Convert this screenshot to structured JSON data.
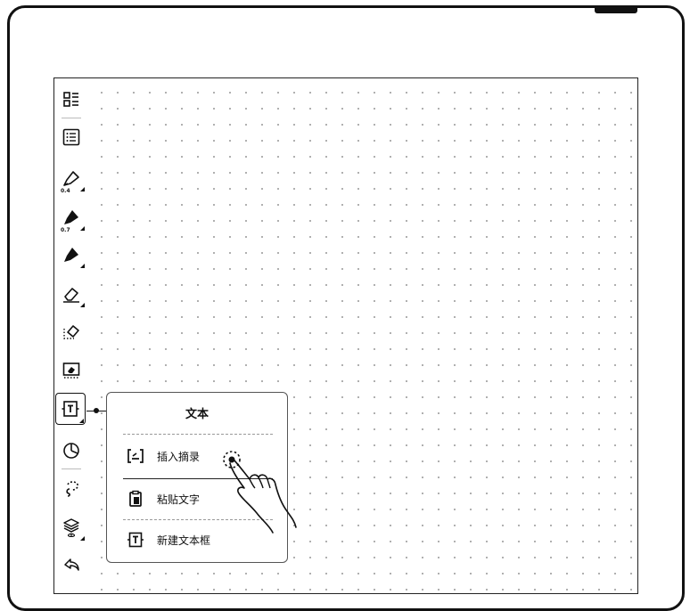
{
  "popup": {
    "title": "文本",
    "items": [
      {
        "label": "插入摘录",
        "icon": "insert-excerpt-icon"
      },
      {
        "label": "粘贴文字",
        "icon": "paste-text-icon"
      },
      {
        "label": "新建文本框",
        "icon": "new-textbox-icon"
      }
    ]
  },
  "toolbar": {
    "pen_size_1": "0.4",
    "pen_size_2": "0.7"
  }
}
